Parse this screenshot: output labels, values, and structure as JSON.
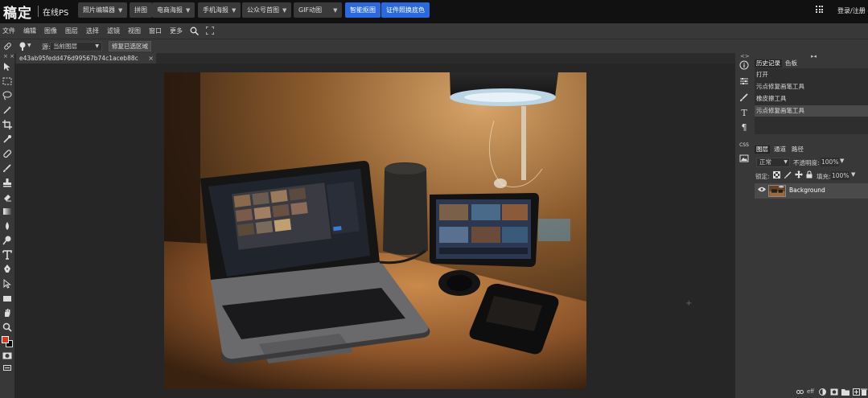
{
  "header": {
    "logo": "稿定",
    "subtitle": "在线PS",
    "nav": [
      {
        "label": "照片编辑器",
        "dropdown": true
      },
      {
        "label": "拼图",
        "dropdown": false
      },
      {
        "label": "电商海报",
        "dropdown": true
      },
      {
        "label": "手机海报",
        "dropdown": true
      },
      {
        "label": "公众号首图",
        "dropdown": true
      },
      {
        "label": "GIF动图",
        "dropdown": true
      },
      {
        "label": "智能抠图",
        "dropdown": false,
        "highlight": true
      },
      {
        "label": "证件照换底色",
        "dropdown": false,
        "highlight": true
      }
    ],
    "apps_icon": "grid-icon",
    "login": "登录/注册"
  },
  "menu": [
    "文件",
    "编辑",
    "图像",
    "图层",
    "选择",
    "滤镜",
    "视图",
    "窗口",
    "更多"
  ],
  "options": {
    "source_label": "源:",
    "source_value": "当前图层",
    "restore_button": "修复已选区域"
  },
  "document": {
    "tab_title": "e43ab95fedd476d99567b74c1aceb88c",
    "close": "×"
  },
  "panels": {
    "history_tab": "历史记录",
    "swatches_tab": "色板",
    "history": [
      "打开",
      "污点修复画笔工具",
      "橡皮擦工具",
      "污点修复画笔工具"
    ],
    "layers_tab": "图层",
    "channels_tab": "通道",
    "paths_tab": "路径",
    "blend_mode": "正常",
    "opacity_label": "不透明度:",
    "opacity_value": "100%",
    "lock_label": "锁定:",
    "fill_label": "填充:",
    "fill_value": "100%",
    "layer_name": "Background",
    "footer": "eff"
  },
  "colors": {
    "accent": "#2a6ae0",
    "foreground": "#e8331b",
    "background": "#000000"
  }
}
